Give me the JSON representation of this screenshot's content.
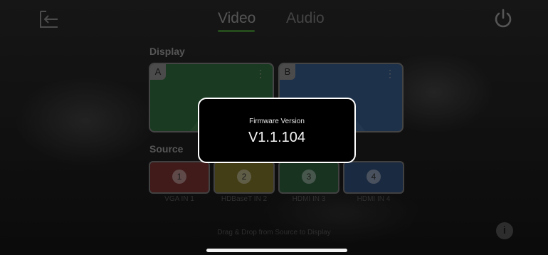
{
  "header": {
    "back_icon": "exit-arrow-icon",
    "tabs": [
      {
        "label": "Video",
        "active": true
      },
      {
        "label": "Audio",
        "active": false
      }
    ],
    "power_icon": "power-icon"
  },
  "display": {
    "title": "Display",
    "cards": [
      {
        "letter": "A",
        "color": "#2b5f37"
      },
      {
        "letter": "B",
        "color": "#2f4f7a"
      }
    ]
  },
  "source": {
    "title": "Source",
    "tiles": [
      {
        "number": "1",
        "label": "VGA IN 1",
        "color": "#6a2b2b"
      },
      {
        "number": "2",
        "label": "HDBaseT IN 2",
        "color": "#6e6426"
      },
      {
        "number": "3",
        "label": "HDMI IN 3",
        "color": "#285536"
      },
      {
        "number": "4",
        "label": "HDMI IN 4",
        "color": "#2b4469"
      }
    ]
  },
  "hint": "Drag & Drop from Source to Display",
  "info_glyph": "i",
  "modal": {
    "label": "Firmware Version",
    "value": "V1.1.104"
  },
  "colors": {
    "accent": "#3d7a2f"
  }
}
